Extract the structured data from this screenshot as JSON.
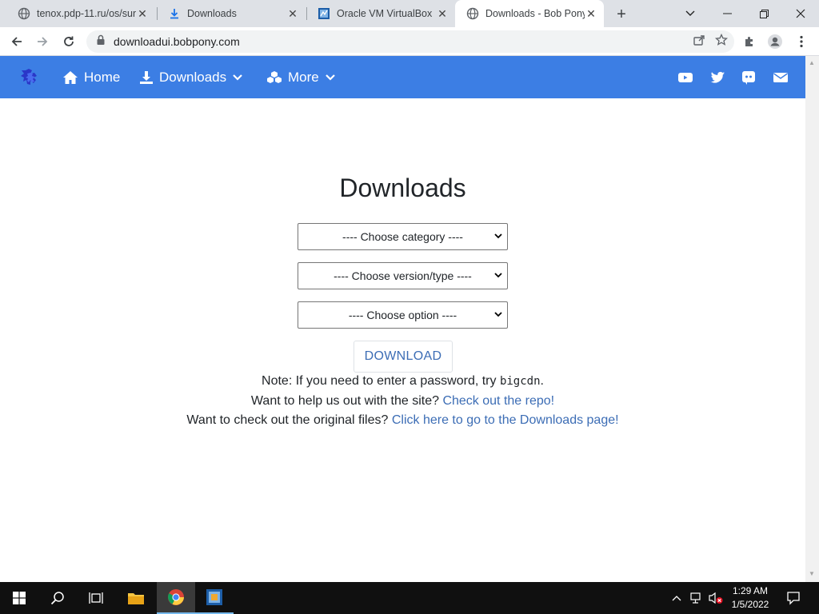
{
  "browser": {
    "tabs": [
      {
        "title": "tenox.pdp-11.ru/os/sun",
        "icon": "globe-icon"
      },
      {
        "title": "Downloads",
        "icon": "download-icon"
      },
      {
        "title": "Oracle VM VirtualBox",
        "icon": "virtualbox-icon"
      },
      {
        "title": "Downloads - Bob Pony",
        "icon": "globe-icon",
        "active": true
      }
    ],
    "url": "downloadui.bobpony.com"
  },
  "navbar": {
    "home": "Home",
    "downloads": "Downloads",
    "more": "More",
    "color": "#3c7ee4"
  },
  "main": {
    "title": "Downloads",
    "category_select": "---- Choose category ----",
    "version_select": "---- Choose version/type ----",
    "option_select": "---- Choose option ----",
    "download_button": "DOWNLOAD",
    "note_prefix": "Note: If you need to enter a password, try ",
    "note_password": "bigcdn",
    "note_suffix": ".",
    "help_prefix": "Want to help us out with the site? ",
    "help_link": "Check out the repo!",
    "files_prefix": "Want to check out the original files? ",
    "files_link": "Click here to go to the Downloads page!"
  },
  "taskbar": {
    "time": "1:29 AM",
    "date": "1/5/2022"
  }
}
